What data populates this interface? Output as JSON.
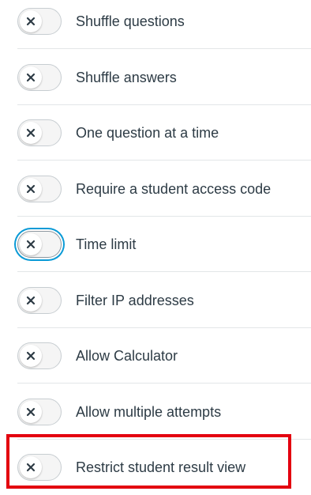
{
  "settings": {
    "items": [
      {
        "label": "Shuffle questions",
        "enabled": false
      },
      {
        "label": "Shuffle answers",
        "enabled": false
      },
      {
        "label": "One question at a time",
        "enabled": false
      },
      {
        "label": "Require a student access code",
        "enabled": false
      },
      {
        "label": "Time limit",
        "enabled": false
      },
      {
        "label": "Filter IP addresses",
        "enabled": false
      },
      {
        "label": "Allow Calculator",
        "enabled": false
      },
      {
        "label": "Allow multiple attempts",
        "enabled": false
      },
      {
        "label": "Restrict student result view",
        "enabled": false
      }
    ],
    "focused_item": "Time limit",
    "highlighted_item": "Restrict student result view"
  },
  "colors": {
    "text": "#2d3b45",
    "toggle_border": "#c7cdd1",
    "focus_ring": "#0a9ad6",
    "highlight": "#e3000f",
    "x_icon": "#2d3b45"
  },
  "icons": {
    "toggle_off": "x-icon"
  }
}
